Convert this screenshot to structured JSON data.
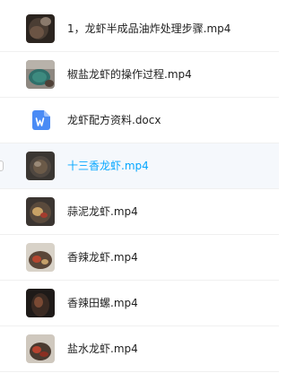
{
  "files": [
    {
      "name": "1，龙虾半成品油炸处理步骤.mp4",
      "type": "video",
      "selected": false
    },
    {
      "name": "椒盐龙虾的操作过程.mp4",
      "type": "video",
      "selected": false
    },
    {
      "name": "龙虾配方资料.docx",
      "type": "word-document",
      "selected": false
    },
    {
      "name": "十三香龙虾.mp4",
      "type": "video",
      "selected": true
    },
    {
      "name": "蒜泥龙虾.mp4",
      "type": "video",
      "selected": false
    },
    {
      "name": "香辣龙虾.mp4",
      "type": "video",
      "selected": false
    },
    {
      "name": "香辣田螺.mp4",
      "type": "video",
      "selected": false
    },
    {
      "name": "盐水龙虾.mp4",
      "type": "video",
      "selected": false
    }
  ],
  "icons": {
    "video_thumbnail": "video-thumbnail-icon",
    "word_document": "word-document-icon"
  },
  "colors": {
    "selected_text": "#06a7ff",
    "selected_row_bg": "#f5f8fc",
    "word_icon": "#4a8bf5",
    "text": "#1f1f1f",
    "divider": "#f0f0f0"
  }
}
